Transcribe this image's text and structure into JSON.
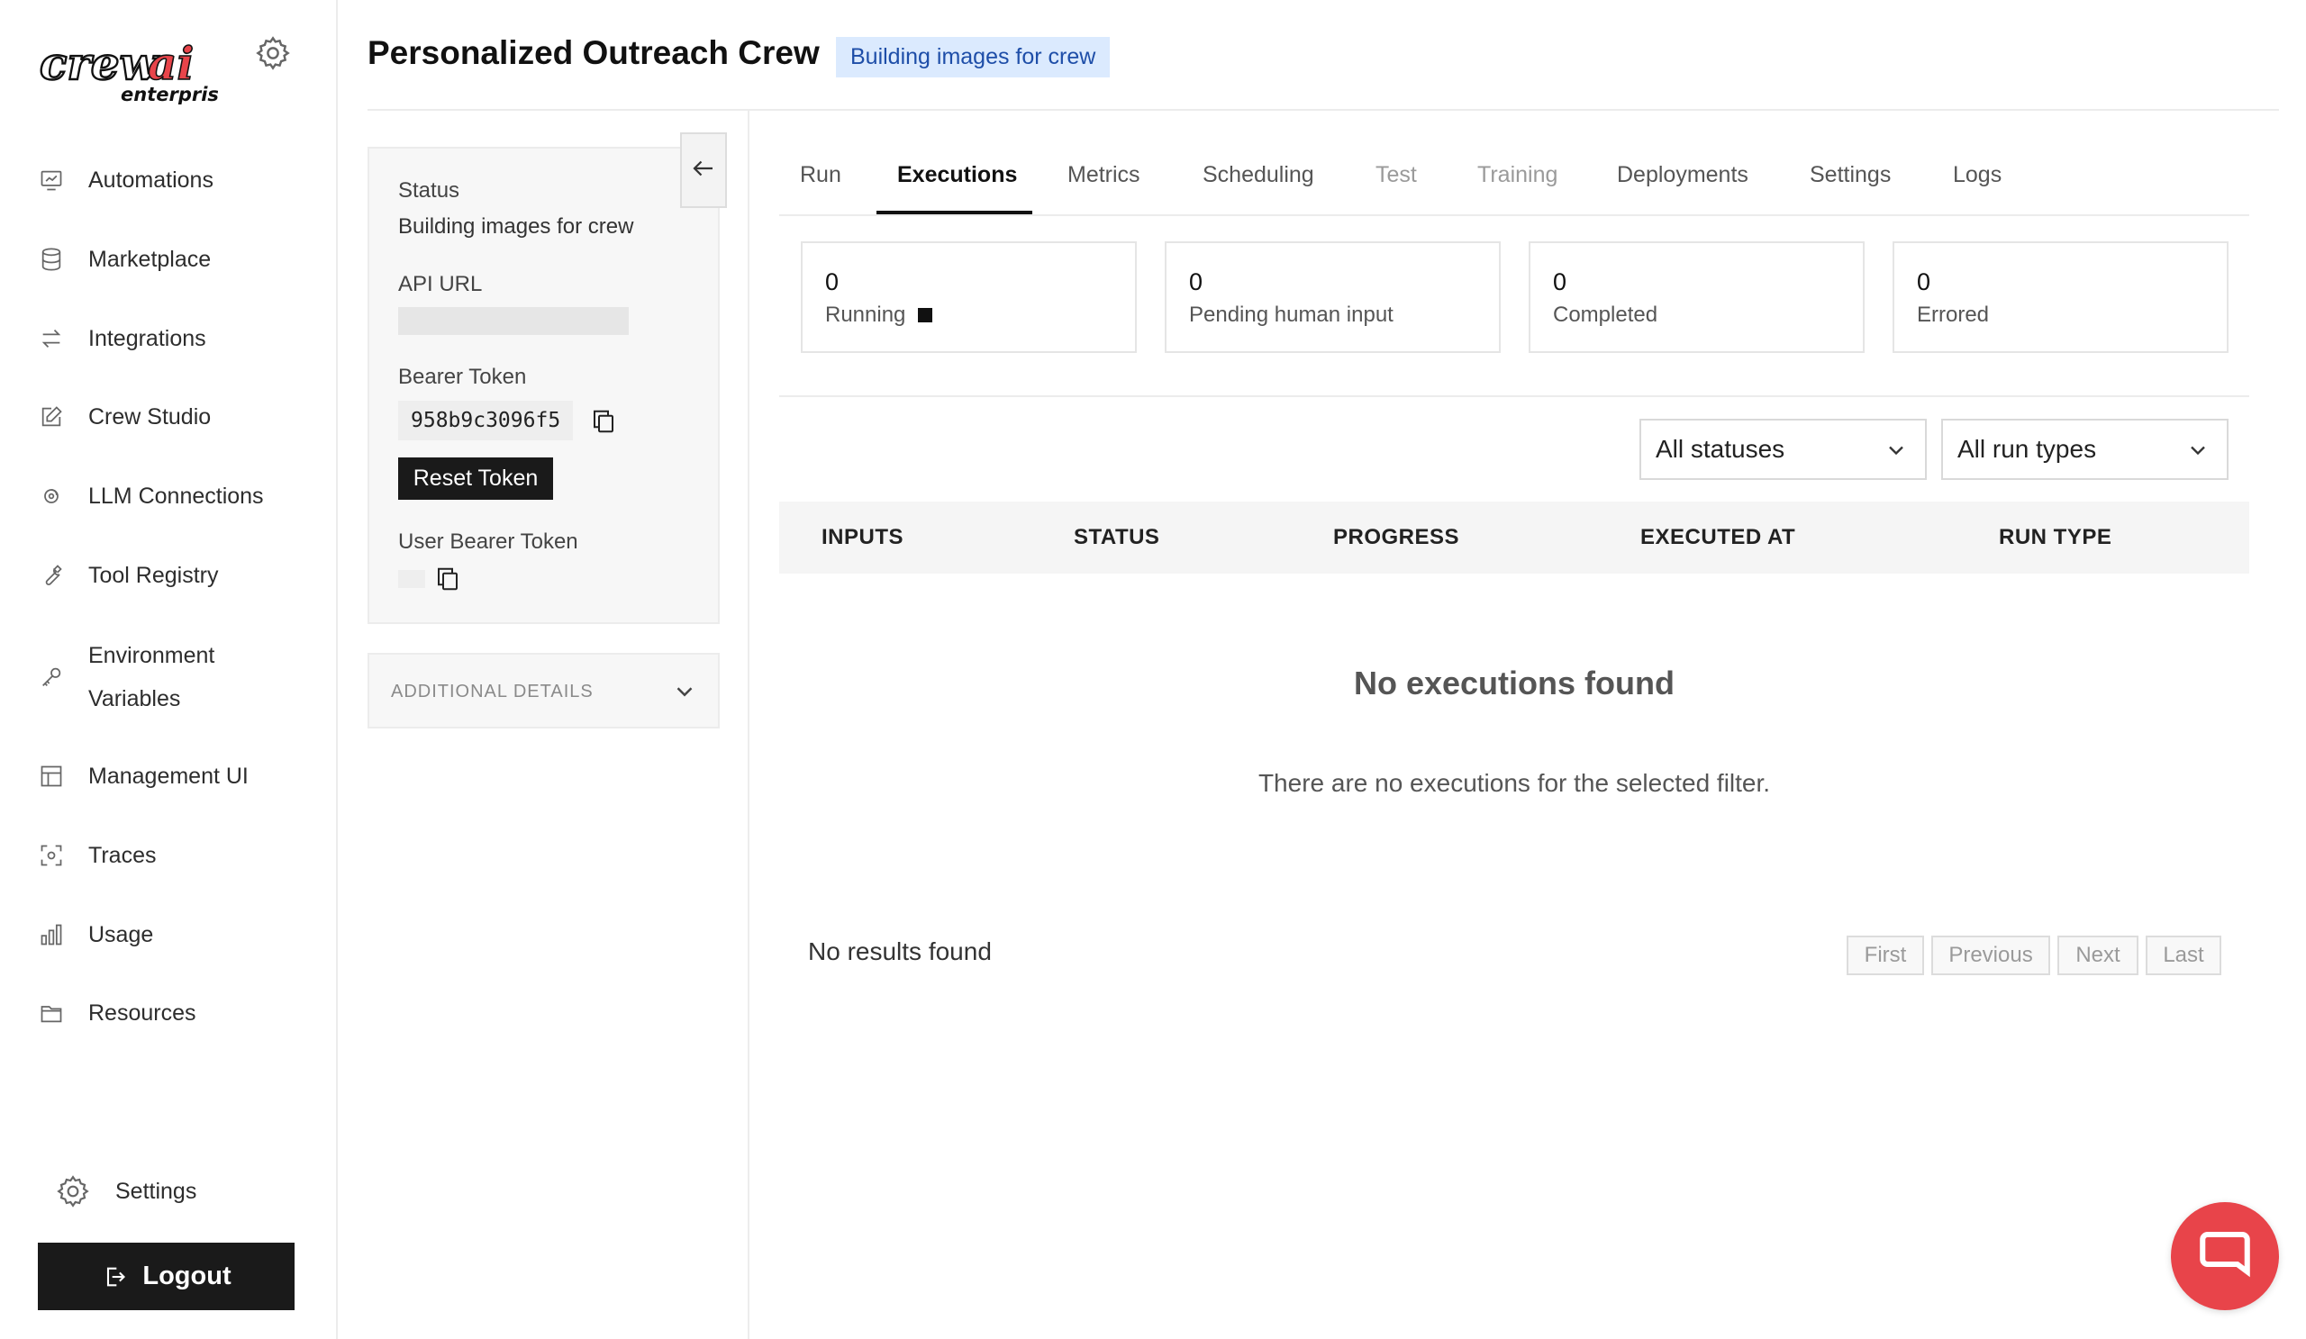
{
  "brand": {
    "logo_text": "crewai",
    "logo_sub": "enterprise",
    "accent": "#e8444a"
  },
  "sidebar": {
    "items": [
      {
        "label": "Automations",
        "icon": "automations-icon"
      },
      {
        "label": "Marketplace",
        "icon": "database-icon"
      },
      {
        "label": "Integrations",
        "icon": "arrows-icon"
      },
      {
        "label": "Crew Studio",
        "icon": "edit-icon"
      },
      {
        "label": "LLM Connections",
        "icon": "llm-icon"
      },
      {
        "label": "Tool Registry",
        "icon": "wrench-icon"
      },
      {
        "label": "Environment Variables",
        "icon": "key-icon"
      },
      {
        "label": "Management UI",
        "icon": "layout-icon"
      },
      {
        "label": "Traces",
        "icon": "traces-icon"
      },
      {
        "label": "Usage",
        "icon": "bar-chart-icon"
      },
      {
        "label": "Resources",
        "icon": "folder-icon"
      }
    ],
    "settings_label": "Settings",
    "logout_label": "Logout"
  },
  "header": {
    "title": "Personalized Outreach Crew",
    "status_badge": "Building images for crew"
  },
  "info": {
    "status_label": "Status",
    "status_value": "Building images for crew",
    "api_url_label": "API URL",
    "bearer_label": "Bearer Token",
    "bearer_value": "958b9c3096f5",
    "reset_label": "Reset Token",
    "user_bearer_label": "User Bearer Token",
    "additional_details": "ADDITIONAL DETAILS"
  },
  "tabs": [
    {
      "label": "Run"
    },
    {
      "label": "Executions"
    },
    {
      "label": "Metrics"
    },
    {
      "label": "Scheduling"
    },
    {
      "label": "Test"
    },
    {
      "label": "Training"
    },
    {
      "label": "Deployments"
    },
    {
      "label": "Settings"
    },
    {
      "label": "Logs"
    }
  ],
  "stats": [
    {
      "value": "0",
      "label": "Running"
    },
    {
      "value": "0",
      "label": "Pending human input"
    },
    {
      "value": "0",
      "label": "Completed"
    },
    {
      "value": "0",
      "label": "Errored"
    }
  ],
  "filters": {
    "status": "All statuses",
    "run_type": "All run types"
  },
  "table": {
    "columns": [
      "INPUTS",
      "STATUS",
      "PROGRESS",
      "EXECUTED AT",
      "RUN TYPE"
    ]
  },
  "empty": {
    "title": "No executions found",
    "subtitle": "There are no executions for the selected filter."
  },
  "pagination": {
    "summary": "No results found",
    "first": "First",
    "previous": "Previous",
    "next": "Next",
    "last": "Last"
  }
}
